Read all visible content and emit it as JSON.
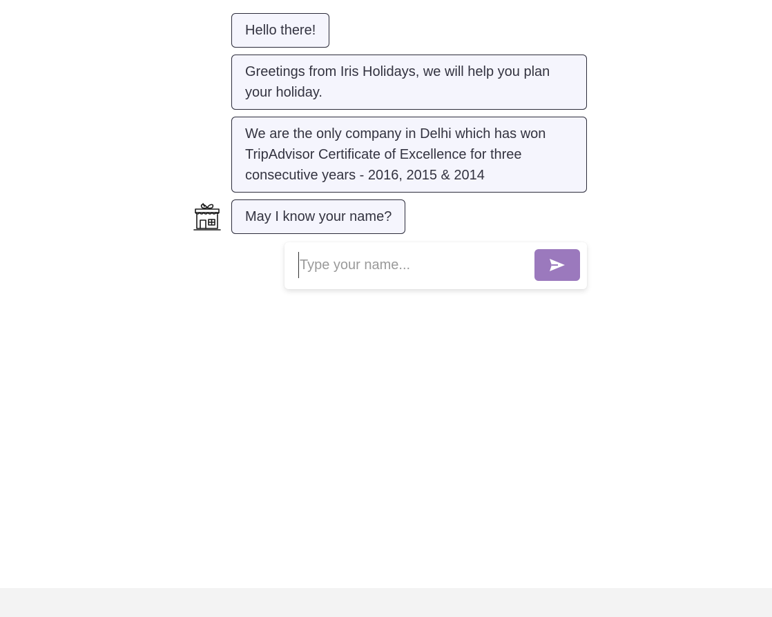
{
  "chat": {
    "messages": [
      {
        "text": "Hello there!"
      },
      {
        "text": "Greetings from Iris Holidays, we will help you plan your holiday."
      },
      {
        "text": "We are the only company in Delhi which has won TripAdvisor Certificate of Excellence for three consecutive years - 2016, 2015 & 2014"
      },
      {
        "text": "May I know your name?"
      }
    ],
    "avatar_icon": "shop-gift-icon"
  },
  "composer": {
    "value": "",
    "placeholder": "Type your name...",
    "send_icon": "send-icon",
    "send_color": "#9b79bd"
  }
}
